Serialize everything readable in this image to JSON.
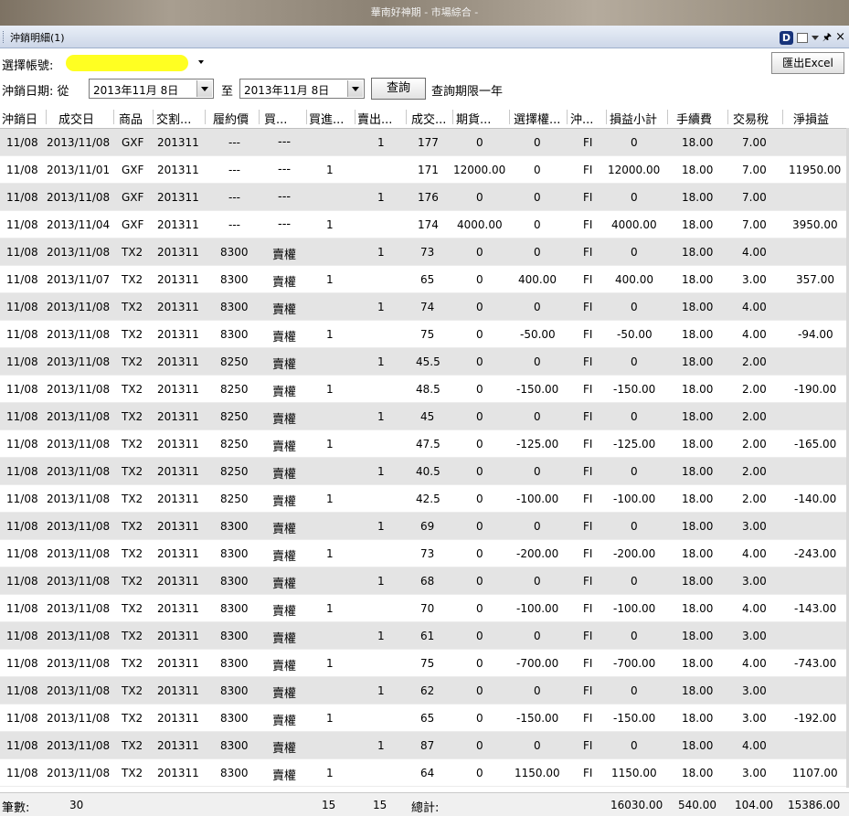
{
  "window": {
    "title": "華南好神期 - 市場綜合 -"
  },
  "panel": {
    "title": "沖銷明細(1)",
    "d_badge": "D"
  },
  "account": {
    "label": "選擇帳號:"
  },
  "export": {
    "label": "匯出Excel"
  },
  "date_filter": {
    "label": "沖銷日期: 從",
    "from": "2013年11月  8日",
    "to_label": "至",
    "to": "2013年11月  8日",
    "query": "查詢",
    "note": "查詢期限一年"
  },
  "columns": [
    "沖銷日",
    "成交日",
    "商品",
    "交割...",
    "履約價",
    "買...",
    "買進...",
    "賣出...",
    "成交...",
    "期貨...",
    "選擇權...",
    "沖...",
    "損益小計",
    "手續費",
    "交易稅",
    "淨損益"
  ],
  "rows": [
    [
      "11/08",
      "2013/11/08",
      "GXF",
      "201311",
      "---",
      "---",
      "",
      "1",
      "177",
      "0",
      "0",
      "FI",
      "0",
      "18.00",
      "7.00",
      ""
    ],
    [
      "11/08",
      "2013/11/01",
      "GXF",
      "201311",
      "---",
      "---",
      "1",
      "",
      "171",
      "12000.00",
      "0",
      "FI",
      "12000.00",
      "18.00",
      "7.00",
      "11950.00"
    ],
    [
      "11/08",
      "2013/11/08",
      "GXF",
      "201311",
      "---",
      "---",
      "",
      "1",
      "176",
      "0",
      "0",
      "FI",
      "0",
      "18.00",
      "7.00",
      ""
    ],
    [
      "11/08",
      "2013/11/04",
      "GXF",
      "201311",
      "---",
      "---",
      "1",
      "",
      "174",
      "4000.00",
      "0",
      "FI",
      "4000.00",
      "18.00",
      "7.00",
      "3950.00"
    ],
    [
      "11/08",
      "2013/11/08",
      "TX2",
      "201311",
      "8300",
      "賣權",
      "",
      "1",
      "73",
      "0",
      "0",
      "FI",
      "0",
      "18.00",
      "4.00",
      ""
    ],
    [
      "11/08",
      "2013/11/07",
      "TX2",
      "201311",
      "8300",
      "賣權",
      "1",
      "",
      "65",
      "0",
      "400.00",
      "FI",
      "400.00",
      "18.00",
      "3.00",
      "357.00"
    ],
    [
      "11/08",
      "2013/11/08",
      "TX2",
      "201311",
      "8300",
      "賣權",
      "",
      "1",
      "74",
      "0",
      "0",
      "FI",
      "0",
      "18.00",
      "4.00",
      ""
    ],
    [
      "11/08",
      "2013/11/08",
      "TX2",
      "201311",
      "8300",
      "賣權",
      "1",
      "",
      "75",
      "0",
      "-50.00",
      "FI",
      "-50.00",
      "18.00",
      "4.00",
      "-94.00"
    ],
    [
      "11/08",
      "2013/11/08",
      "TX2",
      "201311",
      "8250",
      "賣權",
      "",
      "1",
      "45.5",
      "0",
      "0",
      "FI",
      "0",
      "18.00",
      "2.00",
      ""
    ],
    [
      "11/08",
      "2013/11/08",
      "TX2",
      "201311",
      "8250",
      "賣權",
      "1",
      "",
      "48.5",
      "0",
      "-150.00",
      "FI",
      "-150.00",
      "18.00",
      "2.00",
      "-190.00"
    ],
    [
      "11/08",
      "2013/11/08",
      "TX2",
      "201311",
      "8250",
      "賣權",
      "",
      "1",
      "45",
      "0",
      "0",
      "FI",
      "0",
      "18.00",
      "2.00",
      ""
    ],
    [
      "11/08",
      "2013/11/08",
      "TX2",
      "201311",
      "8250",
      "賣權",
      "1",
      "",
      "47.5",
      "0",
      "-125.00",
      "FI",
      "-125.00",
      "18.00",
      "2.00",
      "-165.00"
    ],
    [
      "11/08",
      "2013/11/08",
      "TX2",
      "201311",
      "8250",
      "賣權",
      "",
      "1",
      "40.5",
      "0",
      "0",
      "FI",
      "0",
      "18.00",
      "2.00",
      ""
    ],
    [
      "11/08",
      "2013/11/08",
      "TX2",
      "201311",
      "8250",
      "賣權",
      "1",
      "",
      "42.5",
      "0",
      "-100.00",
      "FI",
      "-100.00",
      "18.00",
      "2.00",
      "-140.00"
    ],
    [
      "11/08",
      "2013/11/08",
      "TX2",
      "201311",
      "8300",
      "賣權",
      "",
      "1",
      "69",
      "0",
      "0",
      "FI",
      "0",
      "18.00",
      "3.00",
      ""
    ],
    [
      "11/08",
      "2013/11/08",
      "TX2",
      "201311",
      "8300",
      "賣權",
      "1",
      "",
      "73",
      "0",
      "-200.00",
      "FI",
      "-200.00",
      "18.00",
      "4.00",
      "-243.00"
    ],
    [
      "11/08",
      "2013/11/08",
      "TX2",
      "201311",
      "8300",
      "賣權",
      "",
      "1",
      "68",
      "0",
      "0",
      "FI",
      "0",
      "18.00",
      "3.00",
      ""
    ],
    [
      "11/08",
      "2013/11/08",
      "TX2",
      "201311",
      "8300",
      "賣權",
      "1",
      "",
      "70",
      "0",
      "-100.00",
      "FI",
      "-100.00",
      "18.00",
      "4.00",
      "-143.00"
    ],
    [
      "11/08",
      "2013/11/08",
      "TX2",
      "201311",
      "8300",
      "賣權",
      "",
      "1",
      "61",
      "0",
      "0",
      "FI",
      "0",
      "18.00",
      "3.00",
      ""
    ],
    [
      "11/08",
      "2013/11/08",
      "TX2",
      "201311",
      "8300",
      "賣權",
      "1",
      "",
      "75",
      "0",
      "-700.00",
      "FI",
      "-700.00",
      "18.00",
      "4.00",
      "-743.00"
    ],
    [
      "11/08",
      "2013/11/08",
      "TX2",
      "201311",
      "8300",
      "賣權",
      "",
      "1",
      "62",
      "0",
      "0",
      "FI",
      "0",
      "18.00",
      "3.00",
      ""
    ],
    [
      "11/08",
      "2013/11/08",
      "TX2",
      "201311",
      "8300",
      "賣權",
      "1",
      "",
      "65",
      "0",
      "-150.00",
      "FI",
      "-150.00",
      "18.00",
      "3.00",
      "-192.00"
    ],
    [
      "11/08",
      "2013/11/08",
      "TX2",
      "201311",
      "8300",
      "賣權",
      "",
      "1",
      "87",
      "0",
      "0",
      "FI",
      "0",
      "18.00",
      "4.00",
      ""
    ],
    [
      "11/08",
      "2013/11/08",
      "TX2",
      "201311",
      "8300",
      "賣權",
      "1",
      "",
      "64",
      "0",
      "1150.00",
      "FI",
      "1150.00",
      "18.00",
      "3.00",
      "1107.00"
    ]
  ],
  "footer": {
    "count_label": "筆數:",
    "count": "30",
    "buy_total": "15",
    "sell_total": "15",
    "total_label": "總計:",
    "pnl_total": "16030.00",
    "fee_total": "540.00",
    "tax_total": "104.00",
    "net_total": "15386.00"
  }
}
